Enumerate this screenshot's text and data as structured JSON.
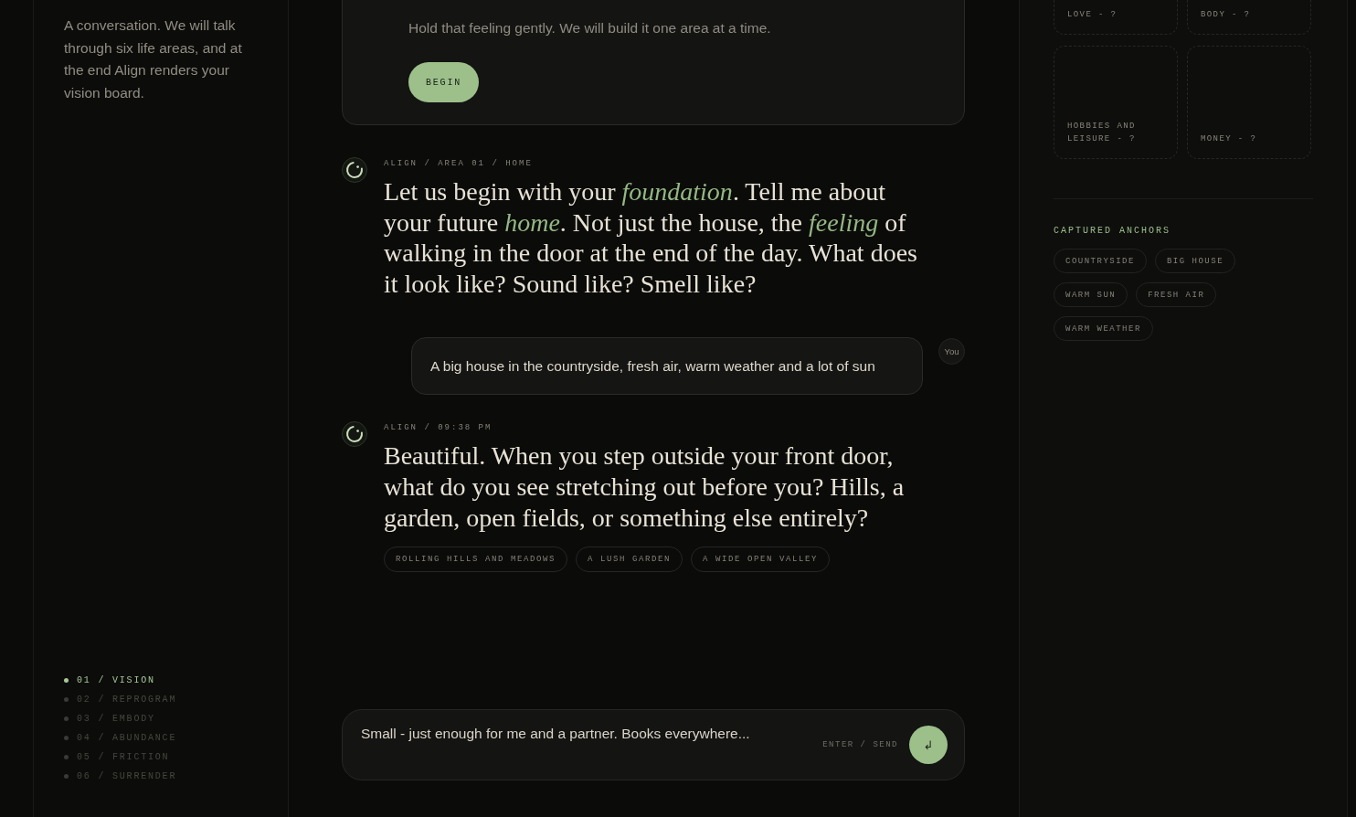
{
  "sidebar": {
    "intro": "A conversation. We will talk through six life areas, and at the end Align renders your vision board.",
    "steps": [
      {
        "label": "01 / VISION",
        "selected": true
      },
      {
        "label": "02 / REPROGRAM",
        "selected": false
      },
      {
        "label": "03 / EMBODY",
        "selected": false
      },
      {
        "label": "04 / ABUNDANCE",
        "selected": false
      },
      {
        "label": "05 / FRICTION",
        "selected": false
      },
      {
        "label": "06 / SURRENDER",
        "selected": false
      }
    ]
  },
  "intro_card": {
    "text": "Hold that feeling gently. We will build it one area at a time.",
    "button": "BEGIN"
  },
  "messages": [
    {
      "kind": "assistant",
      "meta": "ALIGN / AREA 01 / HOME",
      "text": "Let us begin with your *foundation*. Tell me about your future *home*. Not just the house, the *feeling* of walking in the door at the end of the day. What does it look like? Sound like? Smell like?"
    },
    {
      "kind": "user",
      "text": "A big house in the countryside, fresh air, warm weather and a lot of sun",
      "avatar": "You"
    },
    {
      "kind": "assistant",
      "meta": "ALIGN / 09:38 PM",
      "text": "Beautiful. When you step outside your front door, what do you see stretching out before you? Hills, a garden, open fields, or something else entirely?",
      "suggestions": [
        "ROLLING HILLS AND MEADOWS",
        "A LUSH GARDEN",
        "A WIDE OPEN VALLEY"
      ]
    }
  ],
  "composer": {
    "placeholder": "Small - just enough for me and a partner. Books everywhere...",
    "hint": "ENTER / SEND",
    "send_button": "↲"
  },
  "vision_board": {
    "areas": [
      "LOVE - ?",
      "BODY - ?",
      "HOBBIES AND LEISURE - ?",
      "MONEY - ?"
    ],
    "anchors_title": "CAPTURED ANCHORS",
    "anchors": [
      "COUNTRYSIDE",
      "BIG HOUSE",
      "WARM SUN",
      "FRESH AIR",
      "WARM WEATHER"
    ]
  }
}
